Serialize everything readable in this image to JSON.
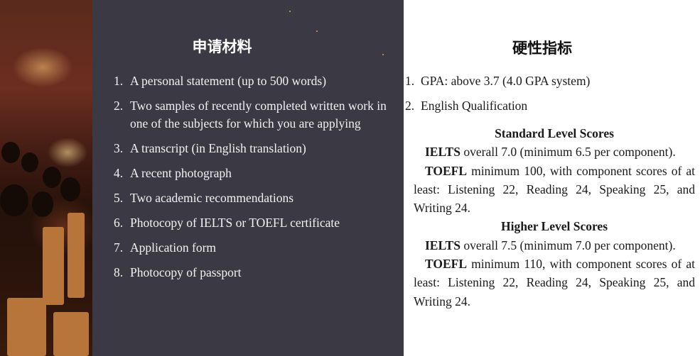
{
  "left": {
    "title": "申请材料",
    "items": [
      {
        "num": "1.",
        "text": "A personal statement (up to 500 words)"
      },
      {
        "num": "2.",
        "text": "Two samples of recently completed written work in one of the subjects for which you are applying"
      },
      {
        "num": "3.",
        "text": "A transcript (in English translation)"
      },
      {
        "num": "4.",
        "text": "A recent photograph"
      },
      {
        "num": "5.",
        "text": "Two academic recommendations"
      },
      {
        "num": "6.",
        "text": "Photocopy of IELTS or TOEFL certificate"
      },
      {
        "num": "7.",
        "text": "Application form"
      },
      {
        "num": "8.",
        "text": "Photocopy of passport"
      }
    ]
  },
  "right": {
    "title": "硬性指标",
    "items": [
      {
        "num": "1.",
        "text": "GPA: above 3.7 (4.0 GPA system)"
      },
      {
        "num": "2.",
        "text": "English Qualification"
      }
    ],
    "standard": {
      "heading": "Standard Level Scores",
      "ielts_label": "IELTS",
      "ielts_text": " overall 7.0 (minimum 6.5 per component).",
      "toefl_label": "TOEFL",
      "toefl_text": " minimum 100, with component scores of at least: Listening 22, Reading 24, Speaking 25, and Writing 24."
    },
    "higher": {
      "heading": "Higher Level Scores",
      "ielts_label": "IELTS",
      "ielts_text": " overall 7.5 (minimum 7.0 per component).",
      "toefl_label": "TOEFL",
      "toefl_text": " minimum 110, with component scores of at least: Listening 22, Reading 24, Speaking 25, and Writing 24."
    }
  },
  "colors": {
    "dark_panel": "#3b3a44",
    "light_panel": "#ffffff"
  }
}
